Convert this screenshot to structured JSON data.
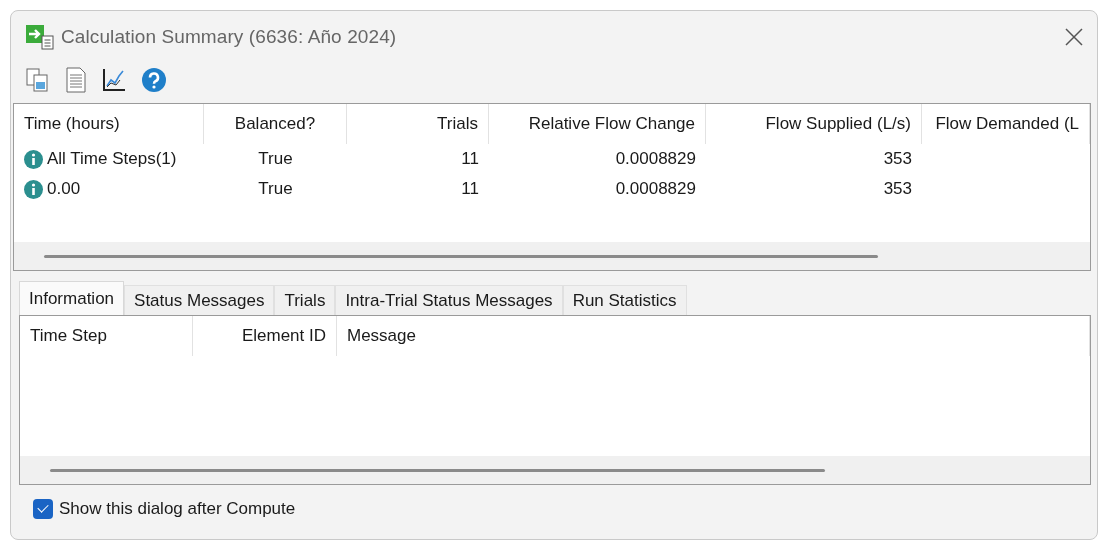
{
  "window": {
    "title": "Calculation Summary (6636: Año 2024)"
  },
  "summary_table": {
    "columns": [
      "Time (hours)",
      "Balanced?",
      "Trials",
      "Relative Flow Change",
      "Flow Supplied (L/s)",
      "Flow Demanded (L"
    ],
    "rows": [
      {
        "cells": [
          "All Time Steps(1)",
          "True",
          "11",
          "0.0008829",
          "353"
        ]
      },
      {
        "cells": [
          "0.00",
          "True",
          "11",
          "0.0008829",
          "353"
        ]
      }
    ]
  },
  "tabs": [
    {
      "label": "Information",
      "selected": true
    },
    {
      "label": "Status Messages",
      "selected": false
    },
    {
      "label": "Trials",
      "selected": false
    },
    {
      "label": "Intra-Trial Status Messages",
      "selected": false
    },
    {
      "label": "Run Statistics",
      "selected": false
    }
  ],
  "messages_table": {
    "columns": [
      "Time Step",
      "Element ID",
      "Message"
    ]
  },
  "show_dialog_option": {
    "label": "Show this dialog after Compute",
    "checked": true
  }
}
